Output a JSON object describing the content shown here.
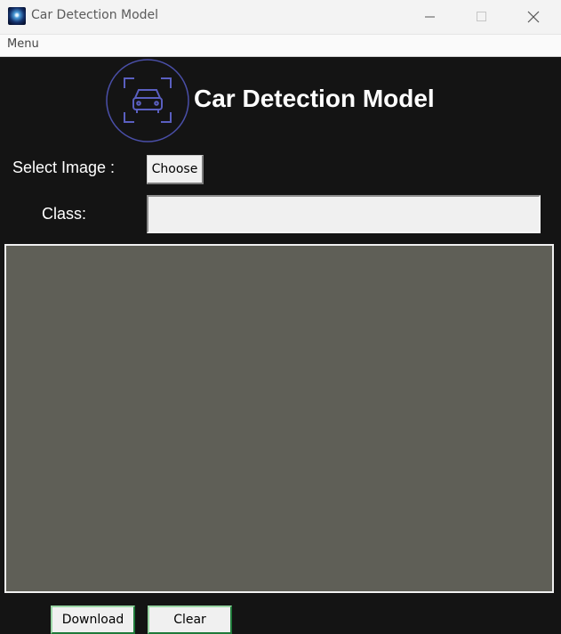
{
  "window": {
    "title": "Car Detection Model"
  },
  "menu": {
    "items": [
      {
        "label": "Menu"
      }
    ]
  },
  "header": {
    "title": "Car Detection Model"
  },
  "form": {
    "select_image_label": "Select Image :",
    "choose_button": "Choose",
    "class_label": "Class:",
    "class_value": ""
  },
  "actions": {
    "download_label": "Download",
    "clear_label": "Clear"
  },
  "colors": {
    "background": "#141414",
    "canvas": "#5f5f57",
    "logo_stroke": "#5a5fc0"
  },
  "icons": [
    "app-icon",
    "minimize-icon",
    "maximize-icon",
    "close-icon",
    "car-scan-logo-icon"
  ]
}
